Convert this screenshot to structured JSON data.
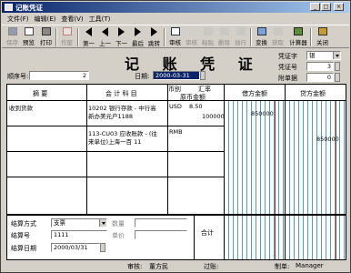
{
  "window": {
    "title": "记账凭证",
    "min_label": "_",
    "max_label": "□",
    "close_label": "×"
  },
  "menu": [
    "文件(F)",
    "编辑(E)",
    "查看(V)",
    "工具(T)"
  ],
  "toolbar": {
    "buttons": [
      {
        "id": "save",
        "label": "保存",
        "icon": "save-icon",
        "enabled": false
      },
      {
        "id": "preview",
        "label": "预览",
        "icon": "preview-icon",
        "enabled": true
      },
      {
        "id": "print",
        "label": "打印",
        "icon": "print-icon",
        "enabled": true
      },
      {
        "id": "cancel",
        "label": "作废",
        "icon": "cancel-icon",
        "enabled": false
      },
      {
        "id": "first",
        "label": "第一",
        "icon": "first-icon",
        "enabled": true
      },
      {
        "id": "prev",
        "label": "上一",
        "icon": "prev-icon",
        "enabled": true
      },
      {
        "id": "next",
        "label": "下一",
        "icon": "next-icon",
        "enabled": true
      },
      {
        "id": "last",
        "label": "最后",
        "icon": "last-icon",
        "enabled": true
      },
      {
        "id": "jump",
        "label": "跳转",
        "icon": "jump-icon",
        "enabled": true
      },
      {
        "id": "audit",
        "label": "审核",
        "icon": "audit-icon",
        "enabled": true
      },
      {
        "id": "unaudit",
        "label": "审核",
        "icon": "unaudit-icon",
        "enabled": false
      },
      {
        "id": "paste",
        "label": "粘贴",
        "icon": "paste-icon",
        "enabled": false
      },
      {
        "id": "delrow",
        "label": "删除",
        "icon": "delete-row-icon",
        "enabled": false
      },
      {
        "id": "insrow",
        "label": "插行",
        "icon": "insert-row-icon",
        "enabled": false
      },
      {
        "id": "convert",
        "label": "变换",
        "icon": "convert-icon",
        "enabled": true
      },
      {
        "id": "fetch",
        "label": "获取",
        "icon": "fetch-icon",
        "enabled": false
      },
      {
        "id": "calc",
        "label": "计算器",
        "icon": "calculator-icon",
        "enabled": true
      },
      {
        "id": "close",
        "label": "关闭",
        "icon": "close-door-icon",
        "enabled": true
      }
    ]
  },
  "voucher": {
    "title": "记 账 凭 证",
    "seq_label": "顺序号:",
    "seq_value": "2",
    "date_label": "日期:",
    "date_value": "2000-03-31",
    "type_label": "凭证字",
    "type_value": "银",
    "number_label": "凭证号",
    "number_value": "3",
    "attach_label": "附单据",
    "attach_value": "0"
  },
  "grid": {
    "headers": {
      "summary": "摘 要",
      "account": "会 计 科 目",
      "currency": "币别",
      "rate": "汇率",
      "orig_amount": "原币金额",
      "debit": "借方金额",
      "credit": "贷方金额"
    },
    "rows": [
      {
        "summary": "收到货款",
        "account_line1": "10202 银行存款 - 中行高",
        "account_line2": "新办美元户1188",
        "currency": "USD",
        "rate": "8.50",
        "orig_amount": "100000",
        "debit": "850000",
        "credit": ""
      },
      {
        "summary": "",
        "account_line1": "113-CU03 应收账款 - (往",
        "account_line2": "来单位)上海一百 11",
        "currency": "RMB",
        "rate": "",
        "orig_amount": "",
        "debit": "",
        "credit": "850000"
      }
    ]
  },
  "settlement": {
    "method_label": "结算方式",
    "method_value": "支票",
    "number_label": "结算号",
    "number_value": "1111",
    "date_label": "结算日期",
    "date_value": "2000/03/31",
    "qty_label": "数量",
    "price_label": "单价",
    "total_label": "合计"
  },
  "footer": {
    "auditor_label": "审核:",
    "auditor_value": "董方民",
    "poster_label": "过账:",
    "poster_value": "",
    "maker_label": "制单:",
    "maker_value": "Manager"
  }
}
